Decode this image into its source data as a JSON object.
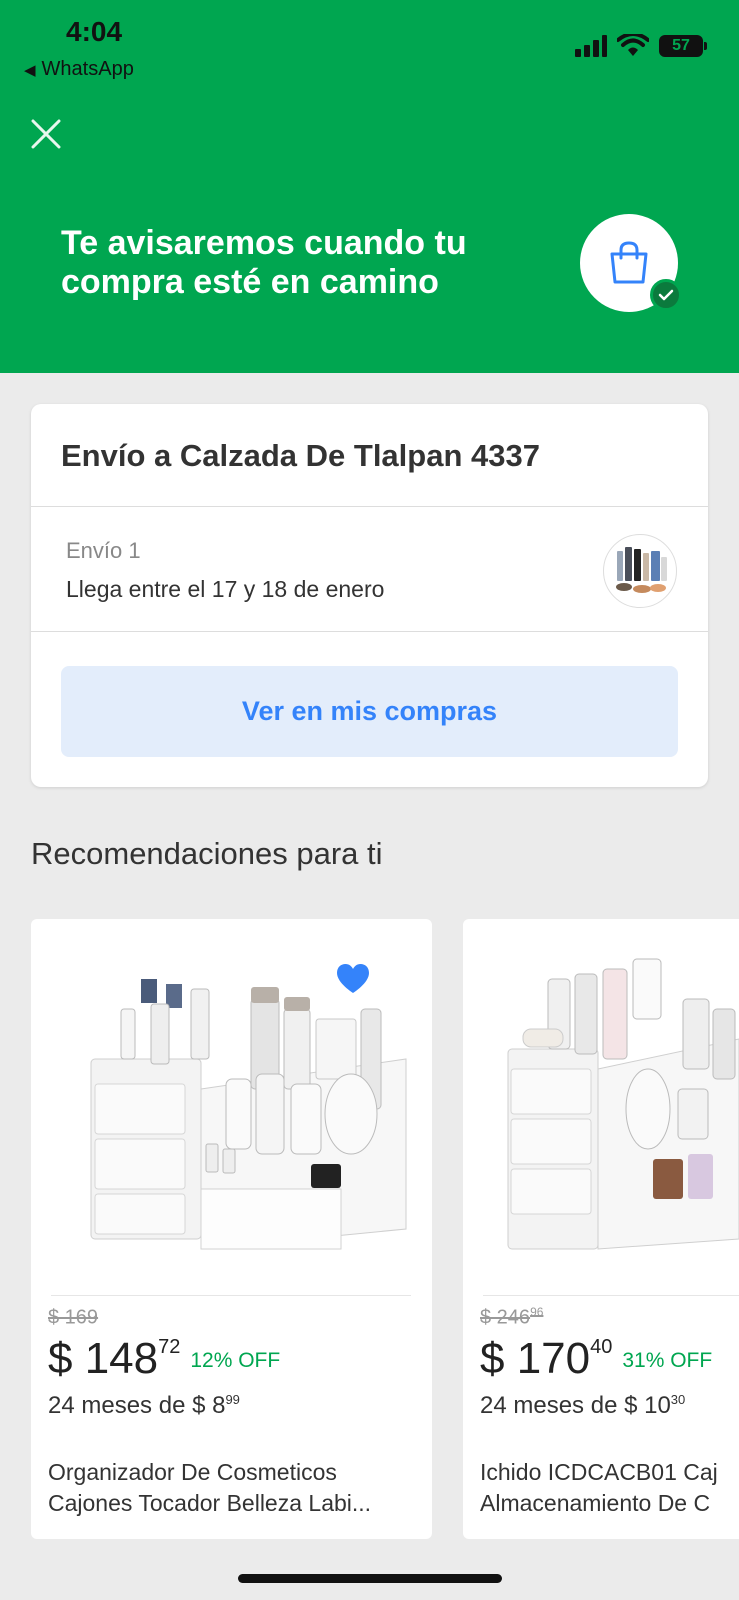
{
  "status_bar": {
    "time": "4:04",
    "back_app": "WhatsApp",
    "battery": "57"
  },
  "header": {
    "title": "Te avisaremos cuando tu compra esté en camino"
  },
  "shipping_card": {
    "title": "Envío a Calzada De Tlalpan 4337",
    "shipment_label": "Envío 1",
    "arrival": "Llega entre el 17 y 18 de enero",
    "button_label": "Ver en mis compras"
  },
  "recommendations": {
    "title": "Recomendaciones para ti",
    "products": [
      {
        "old_price": "$ 169",
        "old_price_cents": "",
        "price": "$ 148",
        "price_cents": "72",
        "discount": "12% OFF",
        "installments": "24 meses de $ 8",
        "installments_cents": "99",
        "name_line1": "Organizador De Cosmeticos",
        "name_line2": "Cajones Tocador Belleza Labi...",
        "favorited": true
      },
      {
        "old_price": "$ 246",
        "old_price_cents": "96",
        "price": "$ 170",
        "price_cents": "40",
        "discount": "31% OFF",
        "installments": "24 meses de $ 10",
        "installments_cents": "30",
        "name_line1": "Ichido ICDCACB01 Caj",
        "name_line2": "Almacenamiento De C"
      }
    ]
  },
  "colors": {
    "brand_green": "#00a650",
    "link_blue": "#3483fa",
    "button_bg": "#e3edfb"
  },
  "icons": [
    "close-icon",
    "shopping-bag-icon",
    "check-icon",
    "heart-icon",
    "signal-icon",
    "wifi-icon",
    "battery-icon"
  ]
}
